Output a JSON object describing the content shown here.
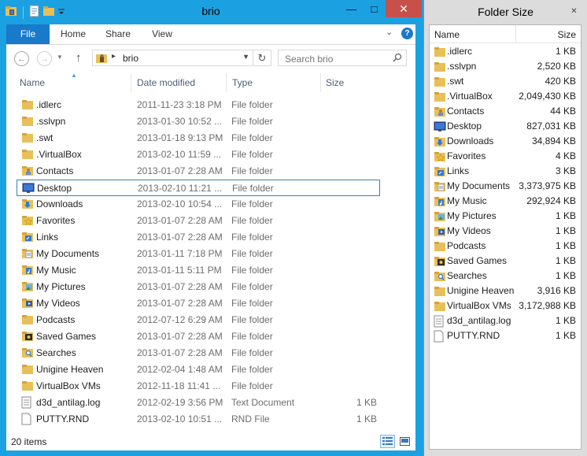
{
  "explorer": {
    "title": "brio",
    "tabs": [
      "File",
      "Home",
      "Share",
      "View"
    ],
    "address": {
      "crumb": "brio"
    },
    "search": {
      "placeholder": "Search brio"
    },
    "columns": {
      "name": "Name",
      "date": "Date modified",
      "type": "Type",
      "size": "Size"
    },
    "items": [
      {
        "name": ".idlerc",
        "date": "2011-11-23 3:18 PM",
        "type": "File folder",
        "size": "",
        "icon": "folder"
      },
      {
        "name": ".sslvpn",
        "date": "2013-01-30 10:52 ...",
        "type": "File folder",
        "size": "",
        "icon": "folder"
      },
      {
        "name": ".swt",
        "date": "2013-01-18 9:13 PM",
        "type": "File folder",
        "size": "",
        "icon": "folder"
      },
      {
        "name": ".VirtualBox",
        "date": "2013-02-10 11:59 ...",
        "type": "File folder",
        "size": "",
        "icon": "folder"
      },
      {
        "name": "Contacts",
        "date": "2013-01-07 2:28 AM",
        "type": "File folder",
        "size": "",
        "icon": "contacts"
      },
      {
        "name": "Desktop",
        "date": "2013-02-10 11:21 ...",
        "type": "File folder",
        "size": "",
        "icon": "desktop",
        "selected": true
      },
      {
        "name": "Downloads",
        "date": "2013-02-10 10:54 ...",
        "type": "File folder",
        "size": "",
        "icon": "downloads"
      },
      {
        "name": "Favorites",
        "date": "2013-01-07 2:28 AM",
        "type": "File folder",
        "size": "",
        "icon": "favorites"
      },
      {
        "name": "Links",
        "date": "2013-01-07 2:28 AM",
        "type": "File folder",
        "size": "",
        "icon": "links"
      },
      {
        "name": "My Documents",
        "date": "2013-01-11 7:18 PM",
        "type": "File folder",
        "size": "",
        "icon": "documents"
      },
      {
        "name": "My Music",
        "date": "2013-01-11 5:11 PM",
        "type": "File folder",
        "size": "",
        "icon": "music"
      },
      {
        "name": "My Pictures",
        "date": "2013-01-07 2:28 AM",
        "type": "File folder",
        "size": "",
        "icon": "pictures"
      },
      {
        "name": "My Videos",
        "date": "2013-01-07 2:28 AM",
        "type": "File folder",
        "size": "",
        "icon": "videos"
      },
      {
        "name": "Podcasts",
        "date": "2012-07-12 6:29 AM",
        "type": "File folder",
        "size": "",
        "icon": "folder"
      },
      {
        "name": "Saved Games",
        "date": "2013-01-07 2:28 AM",
        "type": "File folder",
        "size": "",
        "icon": "games"
      },
      {
        "name": "Searches",
        "date": "2013-01-07 2:28 AM",
        "type": "File folder",
        "size": "",
        "icon": "searches"
      },
      {
        "name": "Unigine Heaven",
        "date": "2012-02-04 1:48 AM",
        "type": "File folder",
        "size": "",
        "icon": "folder"
      },
      {
        "name": "VirtualBox VMs",
        "date": "2012-11-18 11:41 ...",
        "type": "File folder",
        "size": "",
        "icon": "folder"
      },
      {
        "name": "d3d_antilag.log",
        "date": "2012-02-19 3:56 PM",
        "type": "Text Document",
        "size": "1 KB",
        "icon": "textfile"
      },
      {
        "name": "PUTTY.RND",
        "date": "2013-02-10 10:51 ...",
        "type": "RND File",
        "size": "1 KB",
        "icon": "file"
      }
    ],
    "status": {
      "count": "20 items"
    }
  },
  "foldersize": {
    "title": "Folder Size",
    "columns": {
      "name": "Name",
      "size": "Size"
    },
    "items": [
      {
        "name": ".idlerc",
        "size": "1 KB",
        "icon": "folder"
      },
      {
        "name": ".sslvpn",
        "size": "2,520 KB",
        "icon": "folder"
      },
      {
        "name": ".swt",
        "size": "420 KB",
        "icon": "folder"
      },
      {
        "name": ".VirtualBox",
        "size": "2,049,430 KB",
        "icon": "folder"
      },
      {
        "name": "Contacts",
        "size": "44 KB",
        "icon": "contacts"
      },
      {
        "name": "Desktop",
        "size": "827,031 KB",
        "icon": "desktop"
      },
      {
        "name": "Downloads",
        "size": "34,894 KB",
        "icon": "downloads"
      },
      {
        "name": "Favorites",
        "size": "4 KB",
        "icon": "favorites"
      },
      {
        "name": "Links",
        "size": "3 KB",
        "icon": "links"
      },
      {
        "name": "My Documents",
        "size": "3,373,975 KB",
        "icon": "documents"
      },
      {
        "name": "My Music",
        "size": "292,924 KB",
        "icon": "music"
      },
      {
        "name": "My Pictures",
        "size": "1 KB",
        "icon": "pictures"
      },
      {
        "name": "My Videos",
        "size": "1 KB",
        "icon": "videos"
      },
      {
        "name": "Podcasts",
        "size": "1 KB",
        "icon": "folder"
      },
      {
        "name": "Saved Games",
        "size": "1 KB",
        "icon": "games"
      },
      {
        "name": "Searches",
        "size": "1 KB",
        "icon": "searches"
      },
      {
        "name": "Unigine Heaven",
        "size": "3,916 KB",
        "icon": "folder"
      },
      {
        "name": "VirtualBox VMs",
        "size": "3,172,988 KB",
        "icon": "folder"
      },
      {
        "name": "d3d_antilag.log",
        "size": "1 KB",
        "icon": "textfile"
      },
      {
        "name": "PUTTY.RND",
        "size": "1 KB",
        "icon": "file"
      }
    ]
  },
  "colors": {
    "accent": "#1ba1e2",
    "file_tab": "#1979ca",
    "close": "#c7504b",
    "folder": "#e8c05a",
    "selection": "#3c7fb1"
  }
}
